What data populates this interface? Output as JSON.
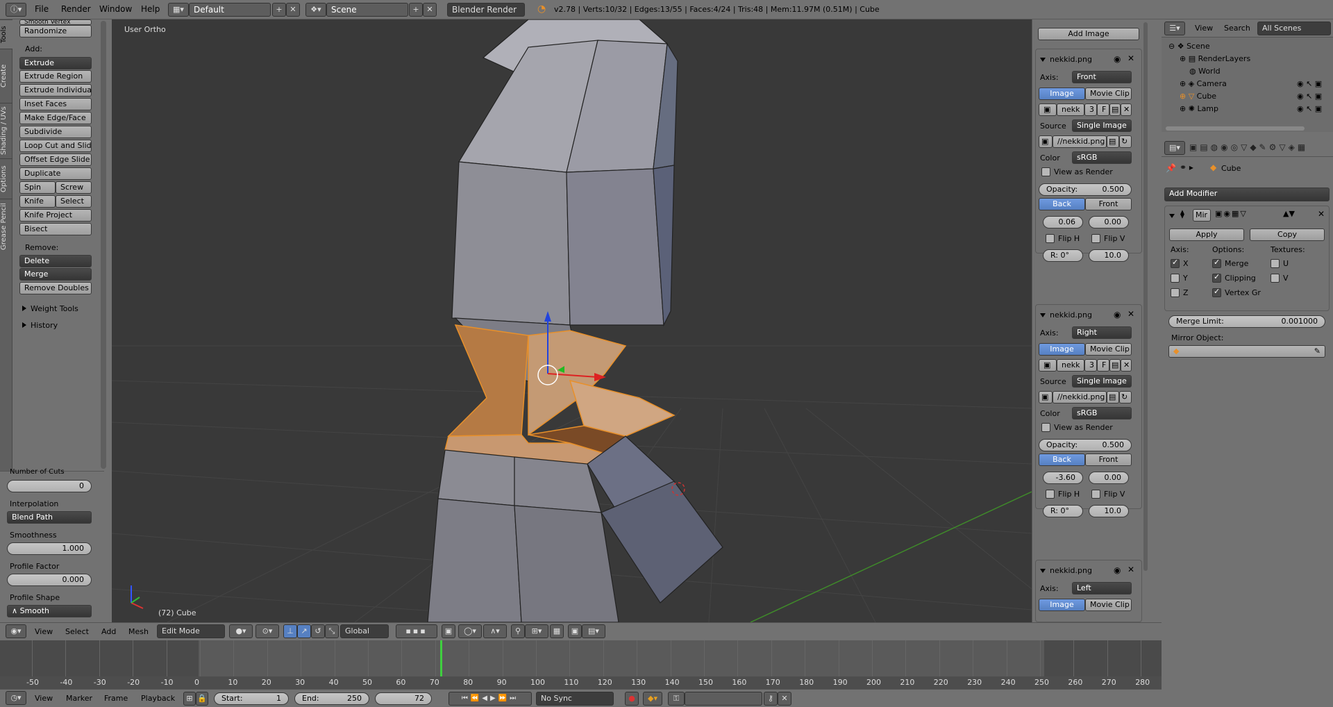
{
  "topbar": {
    "menus": [
      "File",
      "Render",
      "Window",
      "Help"
    ],
    "layout": "Default",
    "scene": "Scene",
    "engine": "Blender Render",
    "stats": "v2.78 | Verts:10/32 | Edges:13/55 | Faces:4/24 | Tris:48 | Mem:11.97M (0.51M) | Cube"
  },
  "tool_tabs": [
    "Tools",
    "Create",
    "Shading / UVs",
    "Options",
    "Grease Pencil"
  ],
  "tools": {
    "top_item": "Smooth Vertex",
    "randomize": "Randomize",
    "add_label": "Add:",
    "extrude": "Extrude",
    "add_items": [
      "Extrude Region",
      "Extrude Individual",
      "Inset Faces",
      "Make Edge/Face",
      "Subdivide",
      "Loop Cut and Slide",
      "Offset Edge Slide",
      "Duplicate"
    ],
    "spin": "Spin",
    "screw": "Screw",
    "knife": "Knife",
    "select": "Select",
    "knife_project": "Knife Project",
    "bisect": "Bisect",
    "remove_label": "Remove:",
    "delete": "Delete",
    "merge": "Merge",
    "remove_doubles": "Remove Doubles",
    "weight_tools": "Weight Tools",
    "history": "History"
  },
  "operator": {
    "number_of_cuts_label": "Number of Cuts",
    "number_of_cuts": "0",
    "interpolation_label": "Interpolation",
    "interpolation": "Blend Path",
    "smoothness_label": "Smoothness",
    "smoothness": "1.000",
    "profile_factor_label": "Profile Factor",
    "profile_factor": "0.000",
    "profile_shape_label": "Profile Shape",
    "profile_shape": "Smooth"
  },
  "viewport": {
    "view_name": "User Ortho",
    "object_info": "(72) Cube"
  },
  "image_panel": {
    "add_image": "Add Image",
    "blocks": [
      {
        "name": "nekkid.png",
        "axis": "Front",
        "offset_x": "0.06",
        "offset_y": "0.00",
        "rotation": "R: 0°",
        "size": "10.0"
      },
      {
        "name": "nekkid.png",
        "axis": "Right",
        "offset_x": "-3.60",
        "offset_y": "0.00",
        "rotation": "R: 0°",
        "size": "10.0"
      },
      {
        "name": "nekkid.png",
        "axis": "Left"
      }
    ],
    "axis_label": "Axis:",
    "image_tab": "Image",
    "movie_clip_tab": "Movie Clip",
    "img_short": "nekk",
    "users": "3",
    "fake": "F",
    "source_label": "Source",
    "source": "Single Image",
    "filepath": "//nekkid.png",
    "color_label": "Color",
    "color": "sRGB",
    "view_as_render": "View as Render",
    "opacity_label": "Opacity:",
    "opacity": "0.500",
    "back": "Back",
    "front": "Front",
    "flip_h": "Flip H",
    "flip_v": "Flip V"
  },
  "outliner": {
    "view": "View",
    "search": "Search",
    "filter": "All Scenes",
    "items": [
      "Scene",
      "RenderLayers",
      "World",
      "Camera",
      "Cube",
      "Lamp"
    ]
  },
  "properties": {
    "object": "Cube",
    "add_modifier": "Add Modifier",
    "modifier_name": "Mir",
    "apply": "Apply",
    "copy": "Copy",
    "axis_label": "Axis:",
    "options_label": "Options:",
    "textures_label": "Textures:",
    "x": "X",
    "y": "Y",
    "z": "Z",
    "merge": "Merge",
    "clipping": "Clipping",
    "vertex_groups": "Vertex Gr",
    "u": "U",
    "v": "V",
    "merge_limit_label": "Merge Limit:",
    "merge_limit": "0.001000",
    "mirror_object_label": "Mirror Object:"
  },
  "view_header": {
    "view": "View",
    "select": "Select",
    "add": "Add",
    "mesh": "Mesh",
    "mode": "Edit Mode",
    "orientation": "Global"
  },
  "timeline": {
    "ticks": [
      "-50",
      "-40",
      "-30",
      "-20",
      "-10",
      "0",
      "10",
      "20",
      "30",
      "40",
      "50",
      "60",
      "70",
      "80",
      "90",
      "100",
      "110",
      "120",
      "130",
      "140",
      "150",
      "160",
      "170",
      "180",
      "190",
      "200",
      "210",
      "220",
      "230",
      "240",
      "250",
      "260",
      "270",
      "280"
    ],
    "current_frame": 72
  },
  "timeline_header": {
    "view": "View",
    "marker": "Marker",
    "frame": "Frame",
    "playback": "Playback",
    "start_label": "Start:",
    "start": "1",
    "end_label": "End:",
    "end": "250",
    "current": "72",
    "sync": "No Sync"
  },
  "colors": {
    "selection": "#e8902a",
    "active_blue": "#5680c2",
    "viewport_bg": "#393939"
  }
}
